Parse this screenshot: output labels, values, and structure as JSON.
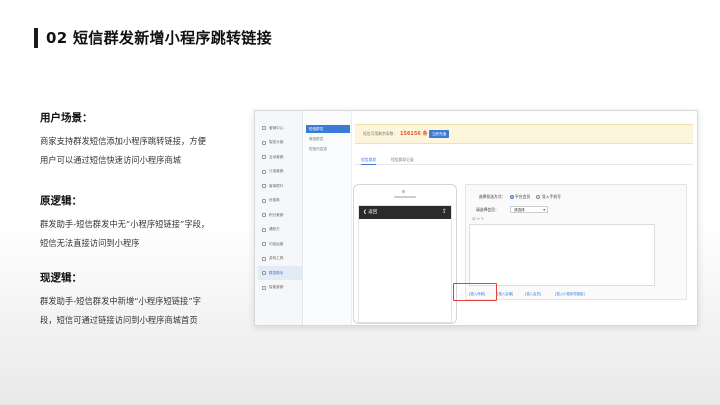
{
  "slide": {
    "title": "02 短信群发新增小程序跳转链接"
  },
  "left": {
    "scenario": {
      "heading": "用户场景：",
      "lines": [
        "商家支持群发短信添加小程序跳转链接，方便",
        "用户可以通过短信快速访问小程序商城"
      ]
    },
    "old_logic": {
      "heading": "原逻辑：",
      "lines": [
        "群发助手-短信群发中无“小程序短链接”字段，",
        "短信无法直接访问到小程序"
      ]
    },
    "new_logic": {
      "heading": "现逻辑：",
      "lines": [
        "群发助手-短信群发中新增“小程序短链接”字",
        "段，短信可通过链接访问到小程序商城首页"
      ]
    }
  },
  "screenshot": {
    "nav_primary": [
      "营销中心",
      "裂变分销",
      "互动营销",
      "订阅营销",
      "客单提升",
      "优惠券",
      "积分营销",
      "通知方",
      "内容运营",
      "游戏工具",
      "群发助手",
      "智能营销"
    ],
    "nav_primary_active_index": 10,
    "nav_secondary": [
      "短信群发",
      "微信群发",
      "短信内容选"
    ],
    "nav_secondary_active_index": 0,
    "balance": {
      "label": "短信可用剩余条数：",
      "value": "156156 条",
      "recharge_label": "立即充值"
    },
    "tabs": [
      "短信群发",
      "短信群发记录"
    ],
    "active_tab_index": 0,
    "phone": {
      "back_label": "返回",
      "share_icon": "share-icon"
    },
    "editor": {
      "send_mode_label": "选择发送方式：",
      "radio_options": [
        "平台会员",
        "导入手机号"
      ],
      "radio_selected_index": 0,
      "member_select_label": "请选择会员：",
      "member_select_value": "请选择",
      "toolbar_glyphs": "☺ ✂ ✎",
      "insert_links": [
        "[插入商城]",
        "[插入店铺]",
        "[插入会员]",
        "[插入小程序短链接]"
      ],
      "highlight_color": "#e0433b"
    }
  }
}
